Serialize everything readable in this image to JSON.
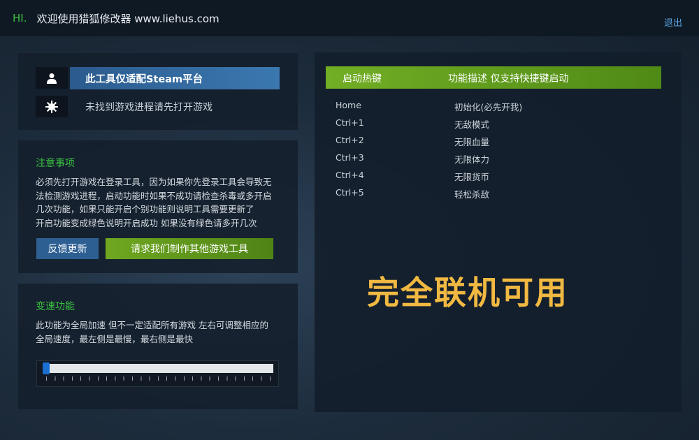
{
  "header": {
    "hi": "HI.",
    "welcome": "欢迎使用猎狐修改器 www.liehus.com",
    "logout": "退出"
  },
  "steam_panel": {
    "platform_label": "此工具仅适配Steam平台",
    "status": "未找到游戏进程请先打开游戏",
    "icons": [
      "user-icon",
      "gear-icon"
    ]
  },
  "notice": {
    "title": "注意事项",
    "lines": [
      "必须先打开游戏在登录工具，因为如果你先登录工具会导致无",
      "法检测游戏进程，启动功能时如果不成功请检查杀毒或多开启",
      "几次功能，如果只能开启个别功能则说明工具需要更新了",
      "开启功能变成绿色说明开启成功 如果没有绿色请多开几次"
    ],
    "feedback_button": "反馈更新",
    "request_button": "请求我们制作其他游戏工具"
  },
  "speed": {
    "title": "变速功能",
    "lines": [
      "此功能为全局加速 但不一定适配所有游戏 左右可调整相应的",
      "全局速度，最左侧是最慢，最右侧是最快"
    ],
    "slider_value": 0
  },
  "hotkeys": {
    "header_key": "启动热键",
    "header_desc": "功能描述 仅支持快捷键启动",
    "rows": [
      {
        "key": "Home",
        "desc": "初始化(必先开我)"
      },
      {
        "key": "Ctrl+1",
        "desc": "无敌模式"
      },
      {
        "key": "Ctrl+2",
        "desc": "无限血量"
      },
      {
        "key": "Ctrl+3",
        "desc": "无限体力"
      },
      {
        "key": "Ctrl+4",
        "desc": "无限货币"
      },
      {
        "key": "Ctrl+5",
        "desc": "轻松杀敌"
      }
    ],
    "online_text": "完全联机可用"
  },
  "colors": {
    "accent_green": "#39c23f",
    "accent_blue": "#2d5f93",
    "highlight_orange": "#f1b942"
  }
}
